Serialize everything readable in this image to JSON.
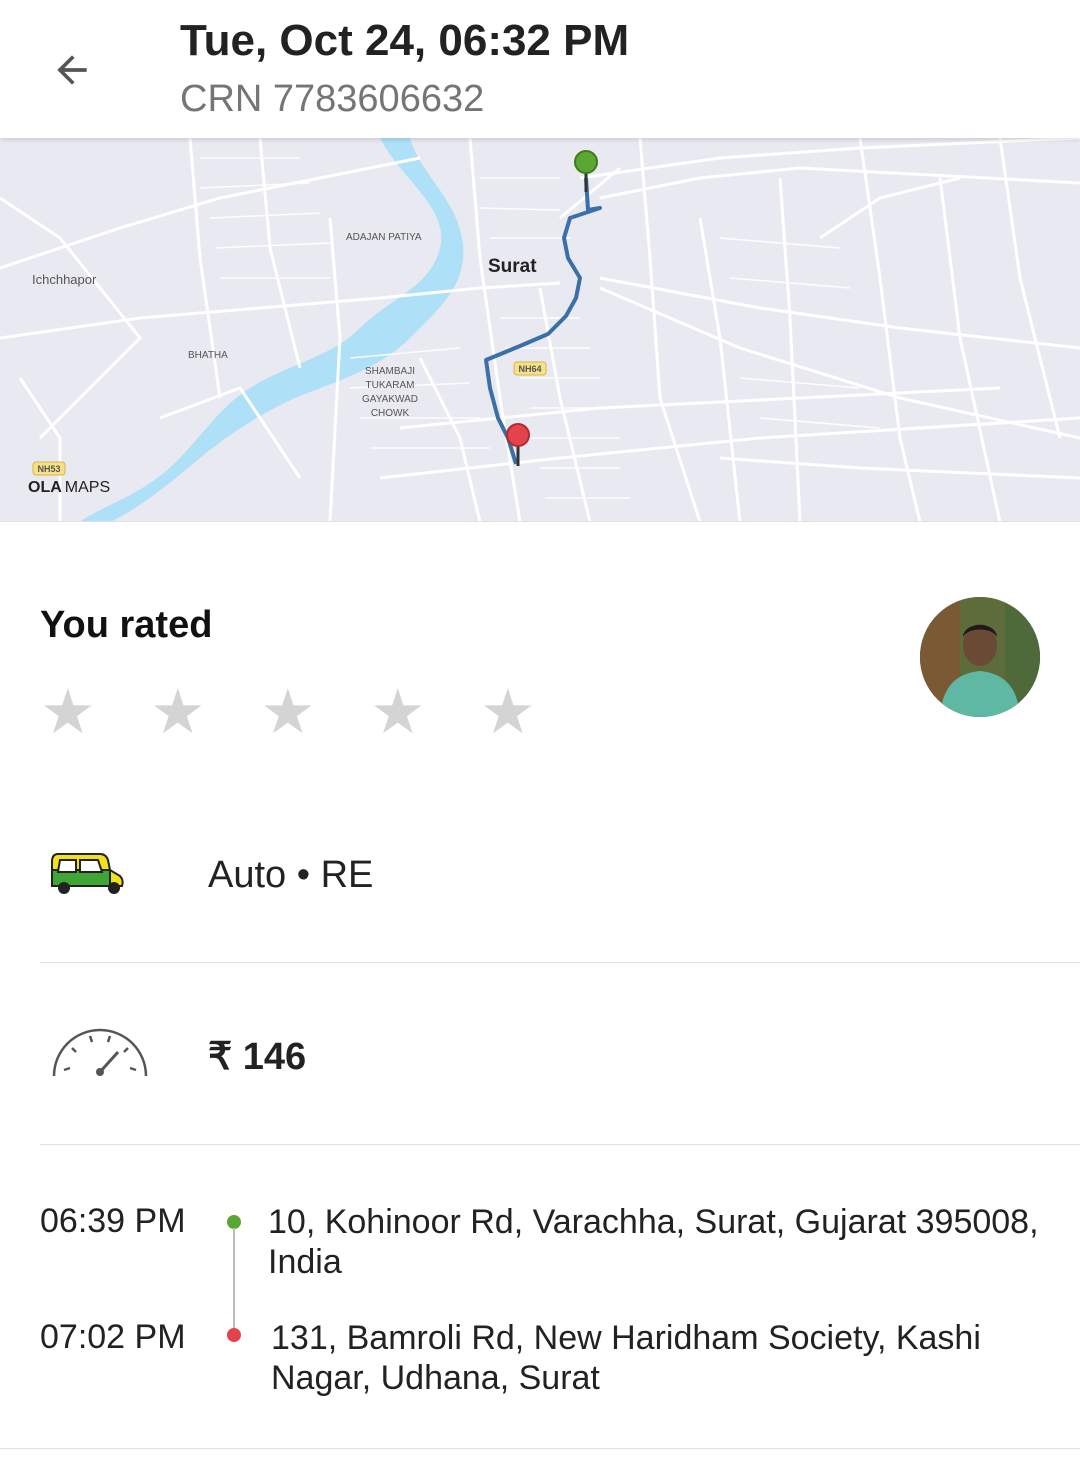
{
  "header": {
    "title": "Tue, Oct 24, 06:32 PM",
    "crn": "CRN 7783606632"
  },
  "map": {
    "labels": {
      "ichchhapor": "Ichchhapor",
      "adajan": "ADAJAN PATIYA",
      "surat": "Surat",
      "bhatha": "BHATHA",
      "shambaji_1": "SHAMBAJI",
      "shambaji_2": "TUKARAM",
      "shambaji_3": "GAYAKWAD",
      "shambaji_4": "CHOWK",
      "nh64": "NH64",
      "nh53": "NH53"
    },
    "logo_ola": "OLA",
    "logo_maps": "MAPS",
    "colors": {
      "water": "#aee0f7",
      "route": "#3b6fa8",
      "pickup": "#5aa832",
      "drop": "#e5434b"
    }
  },
  "rating": {
    "label": "You rated",
    "star_glyph": "★",
    "stars_selected": 0,
    "stars_total": 5
  },
  "vehicle": {
    "label": "Auto • RE"
  },
  "fare": {
    "label": "₹ 146"
  },
  "trip": {
    "pickup_time": "06:39 PM",
    "pickup_address": "10, Kohinoor Rd, Varachha, Surat, Gujarat 395008, India",
    "drop_time": "07:02 PM",
    "drop_address": "131, Bamroli Rd, New Haridham Society, Kashi Nagar, Udhana, Surat"
  }
}
